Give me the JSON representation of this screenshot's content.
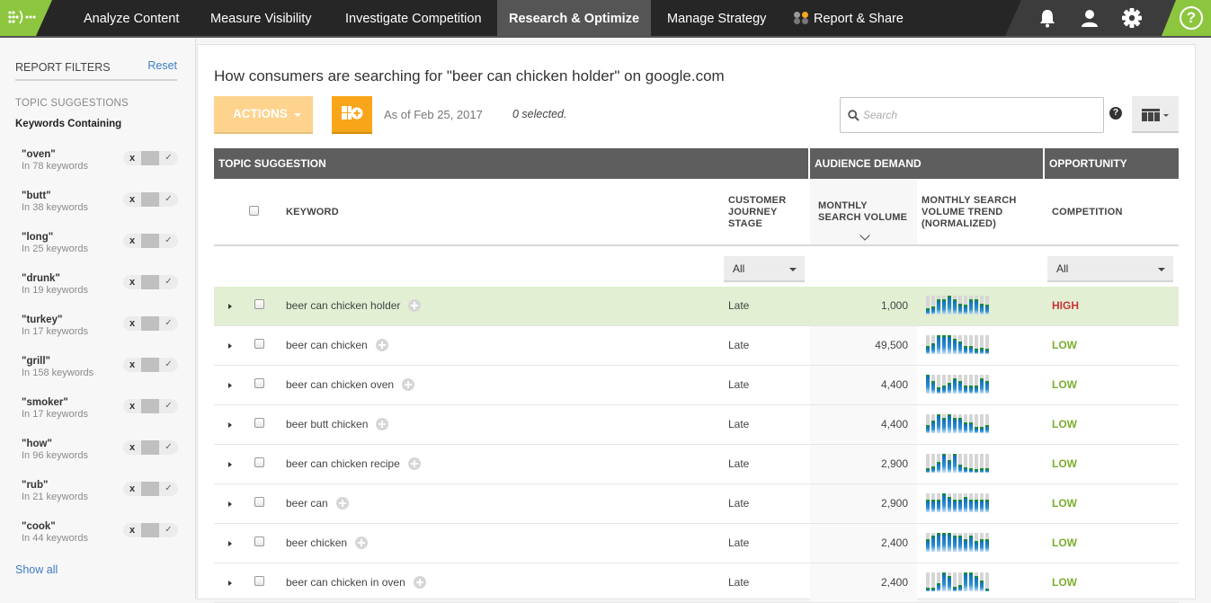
{
  "nav": {
    "items": [
      {
        "label": "Analyze Content",
        "active": false
      },
      {
        "label": "Measure Visibility",
        "active": false
      },
      {
        "label": "Investigate Competition",
        "active": false
      },
      {
        "label": "Research & Optimize",
        "active": true
      },
      {
        "label": "Manage Strategy",
        "active": false
      },
      {
        "label": "Report & Share",
        "active": false
      }
    ],
    "icons": [
      "bell-icon",
      "user-icon",
      "gear-icon",
      "help-icon"
    ],
    "help_glyph": "?",
    "brand_color": "#8cc63f"
  },
  "sidebar": {
    "title": "REPORT FILTERS",
    "reset": "Reset",
    "section": "TOPIC SUGGESTIONS",
    "subsection": "Keywords Containing",
    "toggle_x": "x",
    "toggle_check": "✓",
    "filters": [
      {
        "name": "\"oven\"",
        "count": "In 78 keywords"
      },
      {
        "name": "\"butt\"",
        "count": "In 38 keywords"
      },
      {
        "name": "\"long\"",
        "count": "In 25 keywords"
      },
      {
        "name": "\"drunk\"",
        "count": "In 19 keywords"
      },
      {
        "name": "\"turkey\"",
        "count": "In 17 keywords"
      },
      {
        "name": "\"grill\"",
        "count": "In 158 keywords"
      },
      {
        "name": "\"smoker\"",
        "count": "In 17 keywords"
      },
      {
        "name": "\"how\"",
        "count": "In 96 keywords"
      },
      {
        "name": "\"rub\"",
        "count": "In 21 keywords"
      },
      {
        "name": "\"cook\"",
        "count": "In 44 keywords"
      }
    ],
    "show_all": "Show all"
  },
  "main": {
    "title": "How consumers are searching for \"beer can chicken holder\" on google.com",
    "actions_label": "ACTIONS",
    "as_of": "As of Feb 25, 2017",
    "selected": "0 selected.",
    "search_placeholder": "Search",
    "help_glyph": "?"
  },
  "table": {
    "groups": [
      "TOPIC SUGGESTION",
      "AUDIENCE DEMAND",
      "OPPORTUNITY"
    ],
    "columns": {
      "keyword": "KEYWORD",
      "stage": [
        "CUSTOMER",
        "JOURNEY",
        "STAGE"
      ],
      "volume": [
        "MONTHLY",
        "SEARCH VOLUME"
      ],
      "trend": [
        "MONTHLY SEARCH",
        "VOLUME TREND",
        "(NORMALIZED)"
      ],
      "competition": "COMPETITION"
    },
    "stage_filter": "All",
    "competition_filter": "All",
    "colors": {
      "high": "#c9343a",
      "low": "#7cad2d"
    },
    "rows": [
      {
        "keyword": "beer can chicken holder",
        "stage": "Late",
        "volume": "1,000",
        "competition": "HIGH",
        "highlighted": true,
        "trend": [
          0.35,
          0.45,
          0.8,
          0.8,
          1.0,
          0.8,
          0.55,
          0.5,
          0.8,
          0.8,
          0.55,
          0.5
        ]
      },
      {
        "keyword": "beer can chicken",
        "stage": "Late",
        "volume": "49,500",
        "competition": "LOW",
        "highlighted": false,
        "trend": [
          0.45,
          0.55,
          1.0,
          1.0,
          1.0,
          0.8,
          0.65,
          0.45,
          0.45,
          0.3,
          0.35,
          0.3
        ]
      },
      {
        "keyword": "beer can chicken oven",
        "stage": "Late",
        "volume": "4,400",
        "competition": "LOW",
        "highlighted": false,
        "trend": [
          1.0,
          0.65,
          0.35,
          0.45,
          0.55,
          0.8,
          0.65,
          0.45,
          0.45,
          0.45,
          0.8,
          0.65
        ]
      },
      {
        "keyword": "beer butt chicken",
        "stage": "Late",
        "volume": "4,400",
        "competition": "LOW",
        "highlighted": false,
        "trend": [
          0.45,
          0.65,
          1.0,
          0.8,
          1.0,
          0.8,
          0.8,
          0.55,
          0.55,
          0.35,
          0.35,
          0.45
        ]
      },
      {
        "keyword": "beer can chicken recipe",
        "stage": "Late",
        "volume": "2,900",
        "competition": "LOW",
        "highlighted": false,
        "trend": [
          0.25,
          0.35,
          0.55,
          1.0,
          0.65,
          1.0,
          0.45,
          0.3,
          0.25,
          0.2,
          0.25,
          0.25
        ]
      },
      {
        "keyword": "beer can",
        "stage": "Late",
        "volume": "2,900",
        "competition": "LOW",
        "highlighted": false,
        "trend": [
          0.65,
          0.65,
          0.65,
          1.0,
          0.8,
          0.65,
          0.65,
          0.8,
          0.65,
          0.65,
          0.65,
          0.65
        ]
      },
      {
        "keyword": "beer chicken",
        "stage": "Late",
        "volume": "2,400",
        "competition": "LOW",
        "highlighted": false,
        "trend": [
          0.65,
          0.85,
          1.0,
          1.0,
          1.0,
          0.85,
          0.85,
          0.65,
          0.85,
          0.55,
          0.65,
          0.65
        ]
      },
      {
        "keyword": "beer can chicken in oven",
        "stage": "Late",
        "volume": "2,400",
        "competition": "LOW",
        "highlighted": false,
        "trend": [
          0.2,
          0.2,
          0.45,
          1.0,
          0.8,
          0.25,
          0.35,
          1.0,
          1.0,
          0.8,
          0.55,
          0.15
        ]
      }
    ]
  }
}
